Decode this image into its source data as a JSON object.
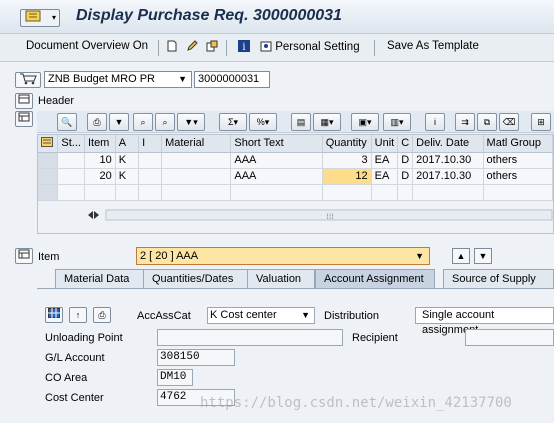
{
  "title": {
    "text": "Display Purchase Req. 3000000031"
  },
  "app_toolbar": {
    "doc_overview": "Document Overview On",
    "personal_setting": "Personal Setting",
    "save_as_template": "Save As Template"
  },
  "header": {
    "doc_type": "ZNB Budget MRO PR",
    "doc_number": "3000000031",
    "header_label": "Header"
  },
  "grid": {
    "columns": [
      "St...",
      "Item",
      "A",
      "I",
      "Material",
      "Short Text",
      "Quantity",
      "Unit",
      "C",
      "Deliv. Date",
      "Matl Group"
    ],
    "rows": [
      {
        "st": "",
        "item": "10",
        "a": "K",
        "i": "",
        "material": "",
        "short_text": "AAA",
        "quantity": "3",
        "unit": "EA",
        "c": "D",
        "deliv_date": "2017.10.30",
        "matl_group": "others"
      },
      {
        "st": "",
        "item": "20",
        "a": "K",
        "i": "",
        "material": "",
        "short_text": "AAA",
        "quantity": "12",
        "unit": "EA",
        "c": "D",
        "deliv_date": "2017.10.30",
        "matl_group": "others"
      }
    ]
  },
  "item_bar": {
    "label": "Item",
    "selected": "2 [ 20 ] AAA"
  },
  "tabs": [
    "Material Data",
    "Quantities/Dates",
    "Valuation",
    "Account Assignment",
    "Source of Supply"
  ],
  "active_tab": "Account Assignment",
  "account": {
    "accasscat_label": "AccAssCat",
    "accasscat_value": "K Cost center",
    "distribution_label": "Distribution",
    "distribution_value": "Single account assignment",
    "unloading_point_label": "Unloading Point",
    "recipient_label": "Recipient",
    "gl_account_label": "G/L Account",
    "gl_account_value": "308150",
    "co_area_label": "CO Area",
    "co_area_value": "DM10",
    "cost_center_label": "Cost Center",
    "cost_center_value": "4762"
  },
  "watermark": "https://blog.csdn.net/weixin_42137700",
  "colors": {
    "highlight": "#fddc8a",
    "title": "#1a2f4d",
    "background": "#eef2f6"
  }
}
